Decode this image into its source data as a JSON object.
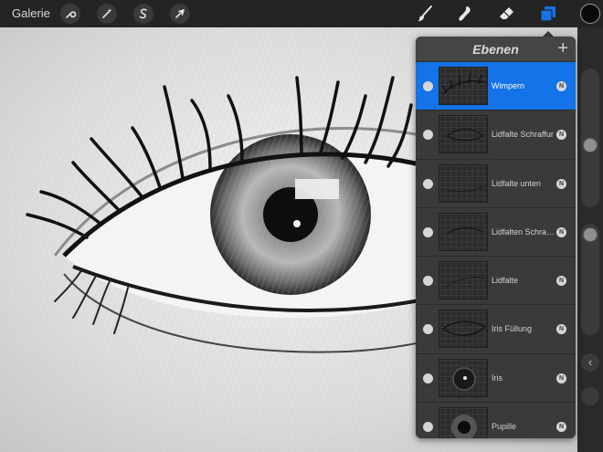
{
  "topbar": {
    "gallery_label": "Galerie",
    "left_tools": [
      "wrench-icon",
      "magic-wand-icon",
      "selection-s-icon",
      "transform-arrow-icon"
    ],
    "right_tools": [
      "brush-icon",
      "smudge-icon",
      "eraser-icon",
      "layers-icon"
    ],
    "active_tool": "layers-icon",
    "active_color": "#0a0a0a",
    "accent_color": "#1473e6"
  },
  "layers_panel": {
    "title": "Ebenen",
    "add_label": "+",
    "layers": [
      {
        "name": "Wimpern",
        "blend": "N",
        "active": true
      },
      {
        "name": "Lidfalte Schraffur",
        "blend": "N",
        "active": false
      },
      {
        "name": "Lidfalte unten",
        "blend": "N",
        "active": false
      },
      {
        "name": "Lidfalten Schraffur",
        "blend": "N",
        "active": false
      },
      {
        "name": "Lidfalte",
        "blend": "N",
        "active": false
      },
      {
        "name": "Iris Füllung",
        "blend": "N",
        "active": false
      },
      {
        "name": "Iris",
        "blend": "N",
        "active": false
      },
      {
        "name": "Pupille",
        "blend": "N",
        "active": false
      }
    ]
  },
  "sidebar": {
    "collapse_label": "‹"
  }
}
